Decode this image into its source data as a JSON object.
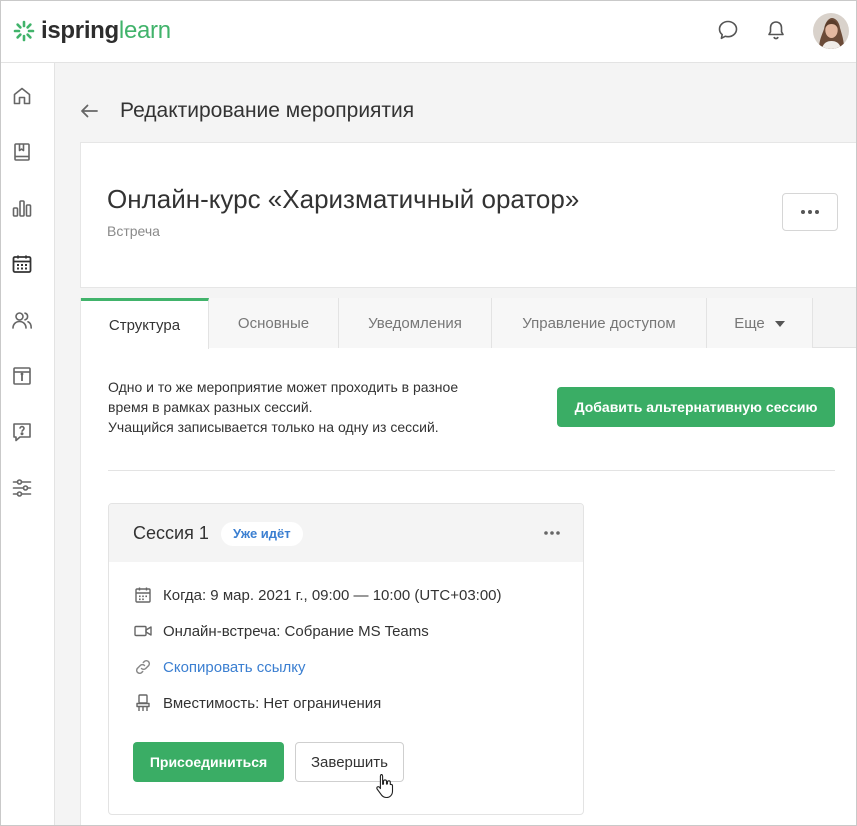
{
  "app": {
    "logo_part1": "ispring",
    "logo_part2": "learn",
    "brand_color": "#41b36b"
  },
  "header": {
    "icons": [
      "chat-icon",
      "bell-icon",
      "user-avatar"
    ]
  },
  "sidebar": {
    "items": [
      {
        "icon": "home-icon"
      },
      {
        "icon": "book-icon"
      },
      {
        "icon": "bar-chart-icon"
      },
      {
        "icon": "calendar-icon"
      },
      {
        "icon": "users-icon"
      },
      {
        "icon": "info-icon"
      },
      {
        "icon": "help-icon"
      },
      {
        "icon": "sliders-icon"
      }
    ]
  },
  "page": {
    "title": "Редактирование мероприятия"
  },
  "event": {
    "title": "Онлайн-курс «Харизматичный оратор»",
    "type": "Встреча"
  },
  "tabs": [
    {
      "label": "Структура",
      "active": true
    },
    {
      "label": "Основные",
      "active": false
    },
    {
      "label": "Уведомления",
      "active": false
    },
    {
      "label": "Управление доступом",
      "active": false
    },
    {
      "label": "Еще",
      "active": false
    }
  ],
  "structure": {
    "info_line1": "Одно и то же мероприятие может проходить в разное",
    "info_line2": "время в рамках разных сессий.",
    "info_line3": "Учащийся записывается только на одну из сессий.",
    "add_session_label": "Добавить альтернативную сессию"
  },
  "session": {
    "title": "Сессия 1",
    "badge": "Уже идёт",
    "when": "Когда: 9 мар. 2021 г., 09:00 — 10:00 (UTC+03:00)",
    "online": "Онлайн-встреча: Собрание MS Teams",
    "copy_link": "Скопировать ссылку",
    "capacity": "Вместимость: Нет ограничения",
    "join_label": "Присоединиться",
    "finish_label": "Завершить"
  }
}
